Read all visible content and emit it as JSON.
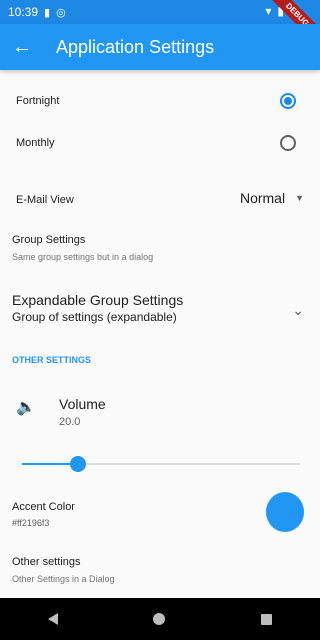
{
  "status": {
    "time": "10:39",
    "sim_icon": "sim-icon",
    "sync_icon": "sync-icon",
    "debug_label": "DEBUG"
  },
  "app_bar": {
    "title": "Application Settings",
    "back_icon": "arrow-back-icon"
  },
  "radio_options": [
    {
      "label": "Fortnight",
      "checked": true
    },
    {
      "label": "Monthly",
      "checked": false
    }
  ],
  "email_view": {
    "label": "E-Mail View",
    "value": "Normal"
  },
  "group_settings": {
    "title": "Group Settings",
    "subtitle": "Same group settings but in a dialog"
  },
  "expandable_group": {
    "title": "Expandable Group Settings",
    "subtitle": "Group of settings (expandable)"
  },
  "other_settings_header": "OTHER SETTINGS",
  "volume": {
    "title": "Volume",
    "value_text": "20.0",
    "slider_fraction": 0.2
  },
  "accent_color": {
    "title": "Accent Color",
    "value": "#ff2196f3",
    "swatch": "#2196f3"
  },
  "other_settings": {
    "title": "Other settings",
    "subtitle": "Other Settings in a Dialog"
  },
  "colors": {
    "primary": "#2196f3",
    "status_bar": "#1e88e5"
  }
}
